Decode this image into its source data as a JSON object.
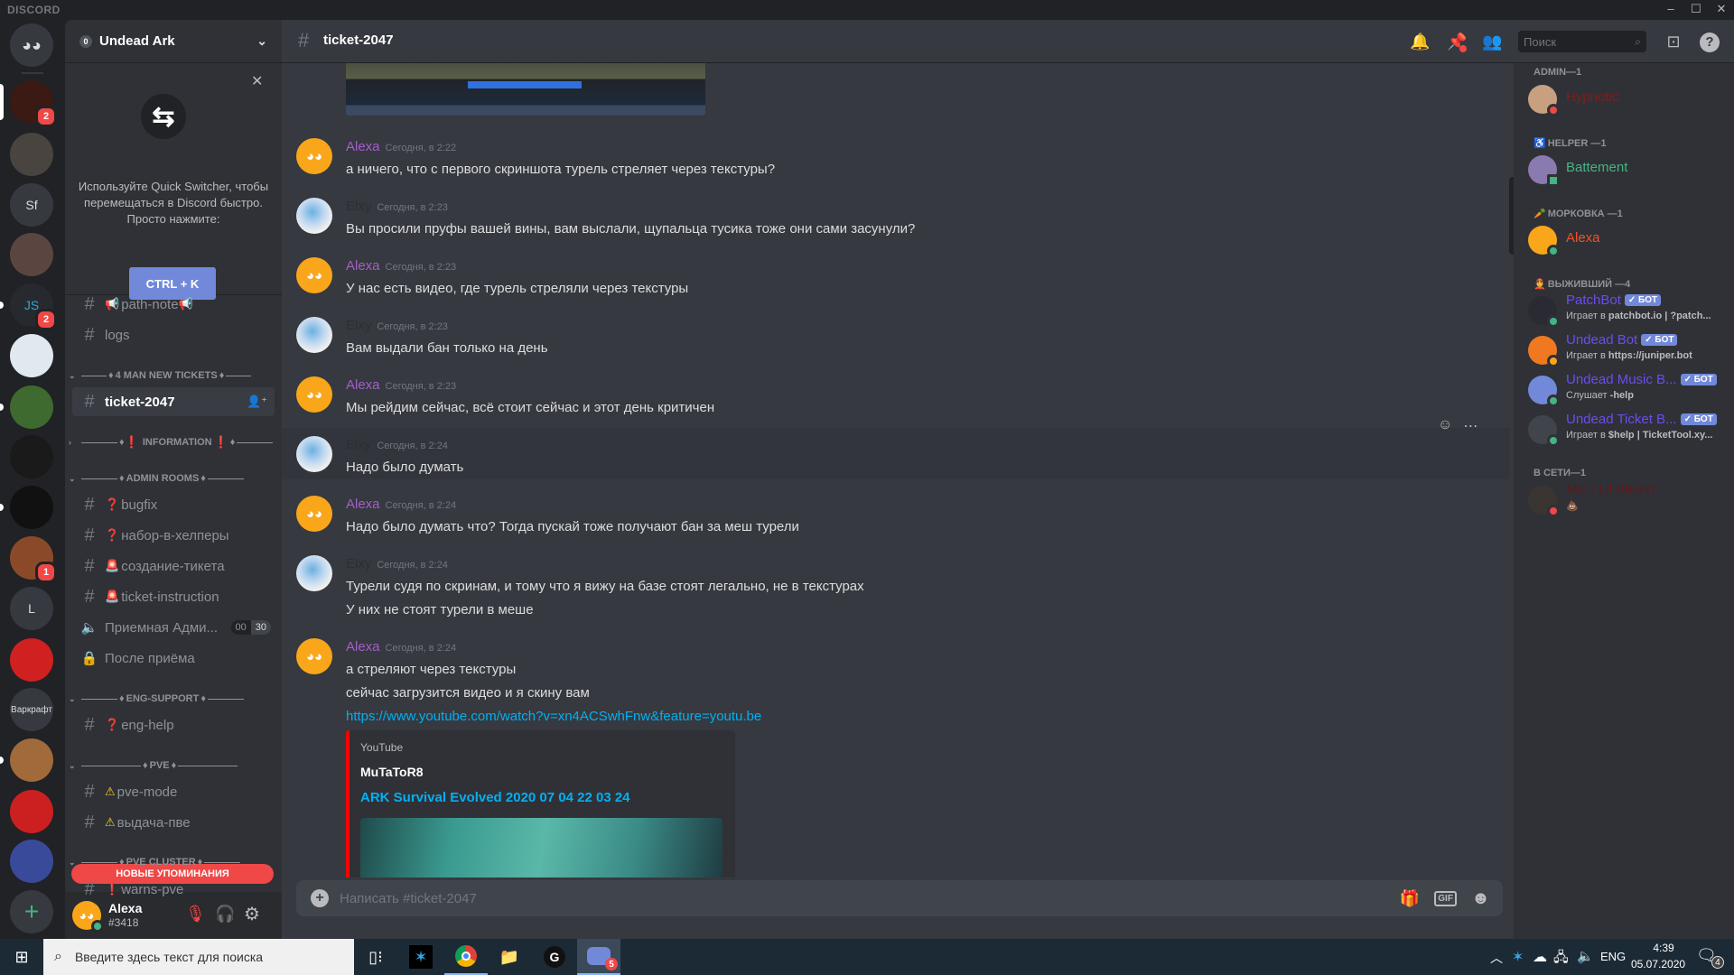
{
  "app": {
    "title": "DISCORD",
    "window_controls": [
      "minimize",
      "maximize",
      "close"
    ]
  },
  "servers": [
    {
      "name": "Discord Home",
      "icon": "discord-logo",
      "color": "#36393f"
    },
    {
      "name": "server-un",
      "color": "#3a1a12",
      "badge": "2",
      "selected": true
    },
    {
      "name": "server-woman-phone",
      "color": "#4a4440"
    },
    {
      "name": "Sf",
      "label": "Sf",
      "color": "#36393f"
    },
    {
      "name": "server-dark-portrait",
      "color": "#5a4540"
    },
    {
      "name": "server-js",
      "label": "JS",
      "color": "#26292e",
      "text_color": "#2fa8d8",
      "badge": "2",
      "unread": true
    },
    {
      "name": "server-swirl",
      "color": "#e0e8f0"
    },
    {
      "name": "server-frog",
      "color": "#3f6a2f",
      "unread": true
    },
    {
      "name": "server-skull",
      "color": "#1a1a1a"
    },
    {
      "name": "server-diamond",
      "color": "#111111",
      "unread": true
    },
    {
      "name": "server-dont-starve",
      "color": "#8a4a2a",
      "badge": "1"
    },
    {
      "name": "L",
      "label": "L",
      "color": "#36393f"
    },
    {
      "name": "server-m",
      "color": "#d02020"
    },
    {
      "name": "Варкрафт",
      "label": "Варкрафт",
      "color": "#36393f"
    },
    {
      "name": "server-cartoon",
      "color": "#a06a3a",
      "unread": true
    },
    {
      "name": "server-play",
      "color": "#cc2020"
    },
    {
      "name": "server-heroes",
      "color": "#3a4a9a"
    },
    {
      "name": "add-server",
      "label": "+",
      "color": "#36393f",
      "text_color": "#43b581"
    }
  ],
  "guild": {
    "name": "Undead Ark",
    "boost_level": "0"
  },
  "quick_switcher": {
    "text": "Используйте Quick Switcher, чтобы перемещаться в Discord быстро. Просто нажмите:",
    "shortcut": "CTRL + K"
  },
  "channels": [
    {
      "type": "text",
      "name": "path-note",
      "emoji": "📢",
      "emoji_after": "📢"
    },
    {
      "type": "text",
      "name": "logs"
    },
    {
      "type": "category",
      "name": "4 MAN NEW TICKETS",
      "collapsed": false
    },
    {
      "type": "text",
      "name": "ticket-2047",
      "selected": true,
      "locked": true
    },
    {
      "type": "category",
      "name": "INFORMATION",
      "collapsed": true,
      "emoji": "❗",
      "emoji_after": "❗"
    },
    {
      "type": "category",
      "name": "ADMIN ROOMS",
      "collapsed": false
    },
    {
      "type": "text",
      "name": "bugfix",
      "emoji": "❓"
    },
    {
      "type": "text",
      "name": "набор-в-хелперы",
      "emoji": "❓"
    },
    {
      "type": "text",
      "name": "создание-тикета",
      "emoji": "🚨"
    },
    {
      "type": "text",
      "name": "ticket-instruction",
      "emoji": "🚨"
    },
    {
      "type": "voice",
      "name": "Приемная Адми...",
      "user_count": "00",
      "user_limit": "30"
    },
    {
      "type": "locked",
      "name": "После приёма"
    },
    {
      "type": "category",
      "name": "ENG-SUPPORT",
      "collapsed": false
    },
    {
      "type": "text",
      "name": "eng-help",
      "emoji": "❓"
    },
    {
      "type": "category",
      "name": "PVE",
      "collapsed": false
    },
    {
      "type": "text",
      "name": "pve-mode",
      "emoji": "⚠"
    },
    {
      "type": "text",
      "name": "выдача-пве",
      "emoji": "⚠"
    },
    {
      "type": "category",
      "name": "PVE CLUSTER",
      "collapsed": false
    },
    {
      "type": "text",
      "name": "warns-pve",
      "emoji": "❗"
    }
  ],
  "new_mentions_label": "НОВЫЕ УПОМИНАНИЯ",
  "user": {
    "name": "Alexa",
    "tag": "#3418",
    "status": "online"
  },
  "header": {
    "channel": "ticket-2047",
    "search_placeholder": "Поиск"
  },
  "messages": [
    {
      "author": "Alexa",
      "color": "#a35fc8",
      "avatar": "default-orange",
      "time": "Сегодня, в 2:22",
      "lines": [
        "а ничего, что с первого скриншота турель стреляет через текстуры?"
      ]
    },
    {
      "author": "Elxy",
      "color": "#2c2f33",
      "avatar": "anime",
      "time": "Сегодня, в 2:23",
      "lines": [
        "Вы просили пруфы вашей вины, вам выслали, щупальца тусика тоже они сами засунули?"
      ]
    },
    {
      "author": "Alexa",
      "color": "#a35fc8",
      "avatar": "default-orange",
      "time": "Сегодня, в 2:23",
      "lines": [
        "У нас есть видео, где турель стреляли через текстуры"
      ]
    },
    {
      "author": "Elxy",
      "color": "#2c2f33",
      "avatar": "anime",
      "time": "Сегодня, в 2:23",
      "lines": [
        "Вам выдали бан только на день"
      ]
    },
    {
      "author": "Alexa",
      "color": "#a35fc8",
      "avatar": "default-orange",
      "time": "Сегодня, в 2:23",
      "lines": [
        "Мы рейдим сейчас, всё стоит сейчас и этот день критичен"
      ]
    },
    {
      "author": "Elxy",
      "color": "#2c2f33",
      "avatar": "anime",
      "time": "Сегодня, в 2:24",
      "lines": [
        "Надо было думать"
      ],
      "hovered": true
    },
    {
      "author": "Alexa",
      "color": "#a35fc8",
      "avatar": "default-orange",
      "time": "Сегодня, в 2:24",
      "lines": [
        "Надо было думать что? Тогда пускай тоже получают бан за меш турели"
      ]
    },
    {
      "author": "Elxy",
      "color": "#2c2f33",
      "avatar": "anime",
      "time": "Сегодня, в 2:24",
      "lines": [
        "Турели судя по скринам, и тому что я вижу на базе стоят  легально,  не в текстурах",
        "У них не стоят турели в меше"
      ]
    },
    {
      "author": "Alexa",
      "color": "#a35fc8",
      "avatar": "default-orange",
      "time": "Сегодня, в 2:24",
      "lines": [
        "а стреляют через текстуры",
        "сейчас загрузится видео и я скину вам"
      ],
      "link": "https://www.youtube.com/watch?v=xn4ACSwhFnw&feature=youtu.be",
      "embed": {
        "provider": "YouTube",
        "author": "MuTaToR8",
        "title": "ARK  Survival Evolved 2020 07 04 22 03 24",
        "color": "#ff0000"
      }
    }
  ],
  "composer": {
    "placeholder": "Написать #ticket-2047",
    "gif_label": "GIF"
  },
  "members": [
    {
      "header": "ADMIN—1",
      "items": [
        {
          "name": "Hypnotic",
          "color": "#7a1f1f",
          "status": "dnd",
          "avatar": "#c8a080"
        }
      ]
    },
    {
      "header": "HELPER —1",
      "emoji": "♿",
      "items": [
        {
          "name": "Battement",
          "color": "#43b581",
          "status": "mobile",
          "avatar": "#8a7ab0"
        }
      ]
    },
    {
      "header": "МОРКОВКА —1",
      "emoji": "🥕",
      "items": [
        {
          "name": "Alexa",
          "color": "#f0502a",
          "status": "online",
          "avatar": "#faa61a"
        }
      ]
    },
    {
      "header": "ВЫЖИВШИЙ —4",
      "emoji": "👲",
      "items": [
        {
          "name": "PatchBot",
          "color": "#6c4cf0",
          "status": "online",
          "bot": "✓ БОТ",
          "activity_prefix": "Играет в ",
          "activity": "patchbot.io | ?patch...",
          "avatar": "#2a2a32"
        },
        {
          "name": "Undead Bot",
          "color": "#6c4cf0",
          "status": "idle",
          "bot": "✓ БОТ",
          "activity_prefix": "Играет в ",
          "activity": "https://juniper.bot",
          "avatar": "#f07820"
        },
        {
          "name": "Undead Music B...",
          "color": "#6c4cf0",
          "status": "online",
          "bot": "✓ БОТ",
          "activity_prefix": "Слушает ",
          "activity": "-help",
          "avatar": "#7289da"
        },
        {
          "name": "Undead Ticket B...",
          "color": "#6c4cf0",
          "status": "online",
          "bot": "✓ БОТ",
          "activity_prefix": "Играет в ",
          "activity": "$help | TicketTool.xy...",
          "avatar": "#40444b"
        }
      ]
    },
    {
      "header": "В СЕТИ—1",
      "items": [
        {
          "name": "MC / Lil ShaNT",
          "color": "#6a1515",
          "status": "dnd",
          "activity": "💩",
          "avatar": "#3a3530"
        }
      ]
    }
  ],
  "taskbar": {
    "search_placeholder": "Введите здесь текст для поиска",
    "apps": [
      "task-view",
      "battle-net",
      "chrome",
      "file-explorer",
      "logitech-g",
      "discord"
    ],
    "discord_badge": "5",
    "tray": {
      "lang": "ENG",
      "time": "4:39",
      "date": "05.07.2020",
      "notifications": "4"
    }
  },
  "colors": {
    "accent": "#7289da",
    "danger": "#f04747",
    "online": "#43b581",
    "idle": "#faa61a",
    "link": "#00b0f4"
  }
}
